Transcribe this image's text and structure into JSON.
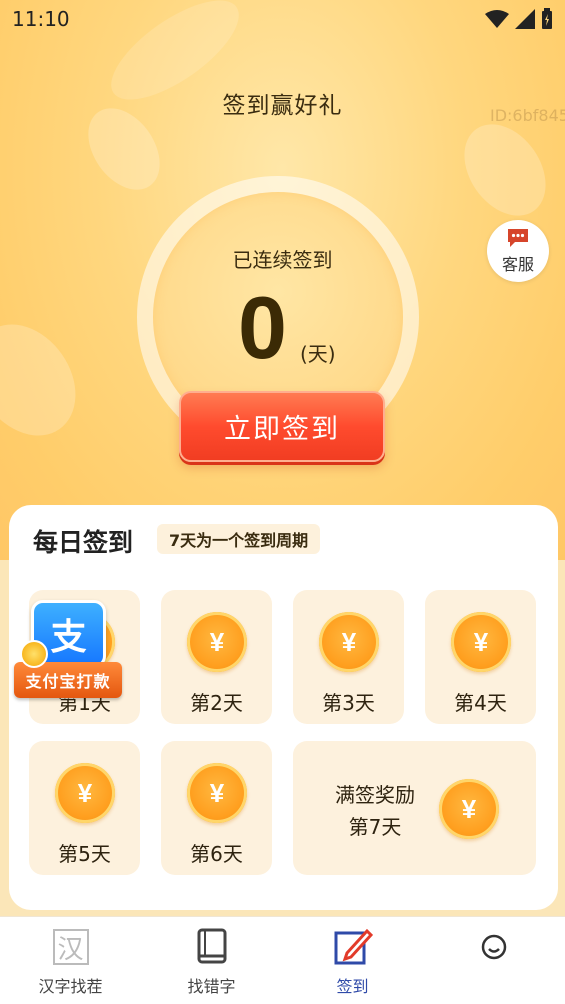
{
  "status_bar": {
    "time": "11:10"
  },
  "header": {
    "title": "签到赢好礼",
    "id_tag": "ID:6bf845"
  },
  "streak": {
    "label": "已连续签到",
    "count": "0",
    "unit": "(天)"
  },
  "checkin_button": {
    "label": "立即签到"
  },
  "customer_service": {
    "label": "客服"
  },
  "daily": {
    "title": "每日签到",
    "cycle_tag": "7天为一个签到周期",
    "days": [
      {
        "label": "第1天",
        "coin": "¥"
      },
      {
        "label": "第2天",
        "coin": "¥"
      },
      {
        "label": "第3天",
        "coin": "¥"
      },
      {
        "label": "第4天",
        "coin": "¥"
      },
      {
        "label": "第5天",
        "coin": "¥"
      },
      {
        "label": "第6天",
        "coin": "¥"
      }
    ],
    "day7": {
      "line1": "满签奖励",
      "line2": "第7天",
      "coin": "¥"
    }
  },
  "alipay_badge": {
    "glyph": "支",
    "banner": "支付宝打款"
  },
  "tabs": [
    {
      "label": "汉字找茬",
      "icon": "han-character-icon",
      "glyph": "汉"
    },
    {
      "label": "找错字",
      "icon": "book-icon"
    },
    {
      "label": "签到",
      "icon": "pen-edit-icon",
      "active": true
    },
    {
      "label": "",
      "icon": "smiley-face-icon"
    }
  ],
  "colors": {
    "accent": "#ff4b2e",
    "active_tab": "#2f4aa8",
    "coin": "#ff9f1f"
  }
}
